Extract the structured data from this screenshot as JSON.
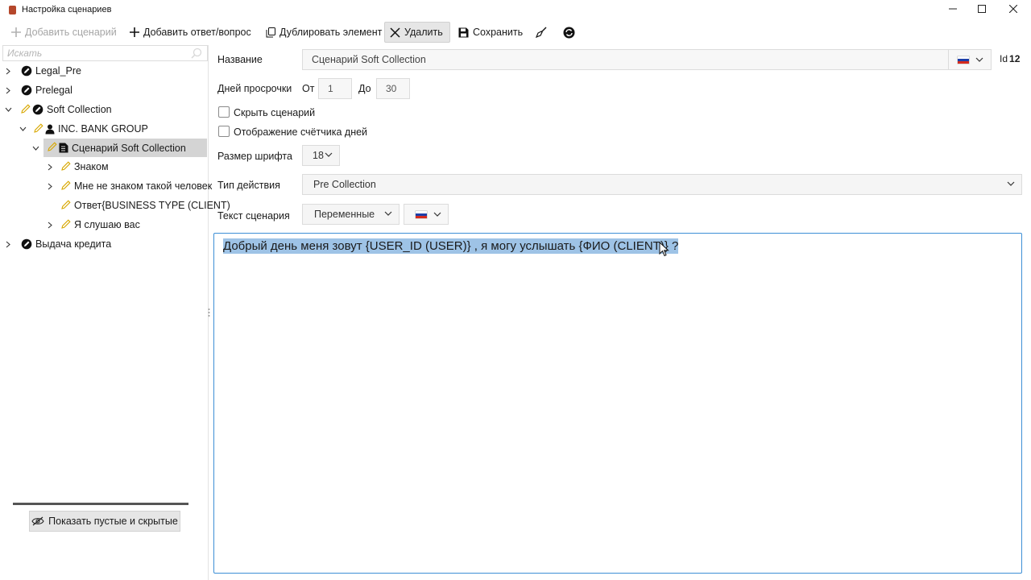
{
  "window": {
    "title": "Настройка сценариев"
  },
  "toolbar": {
    "add_scenario": "Добавить сценарий",
    "add_answer": "Добавить ответ/вопрос",
    "duplicate": "Дублировать элемент",
    "delete": "Удалить",
    "save": "Сохранить"
  },
  "sidebar": {
    "search_placeholder": "Искать",
    "tree": [
      {
        "label": "Legal_Pre"
      },
      {
        "label": "Prelegal"
      },
      {
        "label": "Soft Collection"
      },
      {
        "label": "INC. BANK GROUP"
      },
      {
        "label": "Сценарий Soft Collection"
      },
      {
        "label": "Знаком"
      },
      {
        "label": "Мне не знаком такой человек"
      },
      {
        "label": "Ответ{BUSINESS TYPE (CLIENT)"
      },
      {
        "label": "Я слушаю вас"
      },
      {
        "label": "Выдача кредита"
      }
    ],
    "show_empty_button": "Показать пустые и скрытые"
  },
  "form": {
    "name_label": "Название",
    "name_value": "Сценарий Soft Collection",
    "id_label": "Id",
    "id_value": "12",
    "overdue_label": "Дней просрочки",
    "from_label": "От",
    "from_value": "1",
    "to_label": "До",
    "to_value": "30",
    "hide_label": "Скрыть сценарий",
    "hide_checked": false,
    "counter_label": "Отображение счётчика дней",
    "counter_checked": false,
    "font_size_label": "Размер шрифта",
    "font_size_value": "18",
    "action_type_label": "Тип действия",
    "action_type_value": "Pre Collection",
    "script_text_label": "Текст сценария",
    "variables_value": "Переменные",
    "script_text": "Добрый день меня зовут {USER_ID (USER)} , я могу услышать {ФИО (CLIENT)} ?"
  },
  "colors": {
    "selection": "#9ec3e6",
    "editor_border": "#3d8fd6",
    "tree_selected": "#d4d4d4",
    "pencil": "#d8a700"
  }
}
